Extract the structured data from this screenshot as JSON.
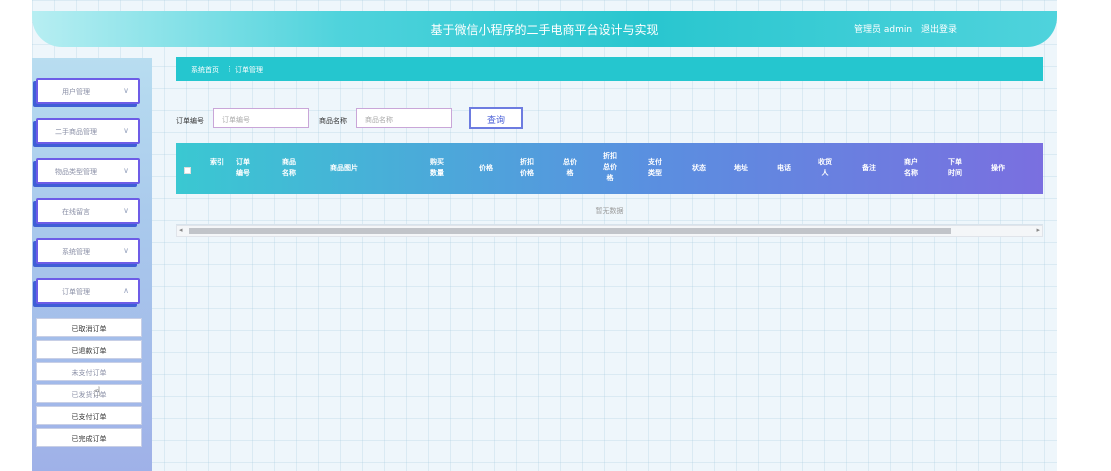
{
  "header": {
    "title": "基于微信小程序的二手电商平台设计与实现",
    "user_label": "管理员 admin",
    "logout_label": "退出登录"
  },
  "sidebar": {
    "menus": [
      {
        "label": "用户管理",
        "chevron": "∨"
      },
      {
        "label": "二手商品管理",
        "chevron": "∨"
      },
      {
        "label": "物品类型管理",
        "chevron": "∨"
      },
      {
        "label": "在线留言",
        "chevron": "∨"
      },
      {
        "label": "系统管理",
        "chevron": "∨"
      },
      {
        "label": "订单管理",
        "chevron": "∧"
      }
    ],
    "submenu": [
      {
        "label": "已取消订单"
      },
      {
        "label": "已退款订单"
      },
      {
        "label": "未支付订单"
      },
      {
        "label": "已发货订单"
      },
      {
        "label": "已支付订单"
      },
      {
        "label": "已完成订单"
      }
    ]
  },
  "breadcrumb": {
    "home": "系统首页",
    "separator": "⋮",
    "current": "订单管理"
  },
  "search": {
    "order_no_label": "订单编号",
    "order_no_placeholder": "订单编号",
    "product_name_label": "商品名称",
    "product_name_placeholder": "商品名称",
    "query_button": "查询"
  },
  "table": {
    "columns": [
      "索引",
      "订单编号",
      "商品名称",
      "商品图片",
      "购买数量",
      "价格",
      "折扣价格",
      "总价格",
      "折扣总价格",
      "支付类型",
      "状态",
      "地址",
      "电话",
      "收货人",
      "备注",
      "商户名称",
      "下单时间",
      "操作"
    ],
    "empty_text": "暂无数据"
  },
  "colors": {
    "accent": "#25c6cf",
    "menu_border": "#6d5ce7"
  }
}
